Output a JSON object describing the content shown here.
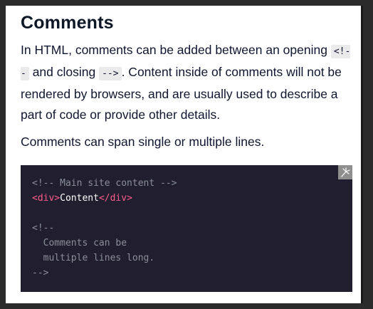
{
  "heading": "Comments",
  "para1": {
    "text_a": "In HTML, comments can be added between an opening ",
    "code_open": "<!--",
    "text_b": " and closing ",
    "code_close": "-->",
    "text_c": ". Content inside of comments will not be rendered by browsers, and are usually used to describe a part of code or provide other details."
  },
  "para2": "Comments can span single or multiple lines.",
  "code": {
    "line1": "<!-- Main site content -->",
    "line2_open_tag": "<div>",
    "line2_text": "Content",
    "line2_close_tag": "</div>",
    "line4": "<!--",
    "line5": "  Comments can be",
    "line6": "  multiple lines long.",
    "line7": "-->"
  },
  "icons": {
    "copy": "copy-icon"
  }
}
